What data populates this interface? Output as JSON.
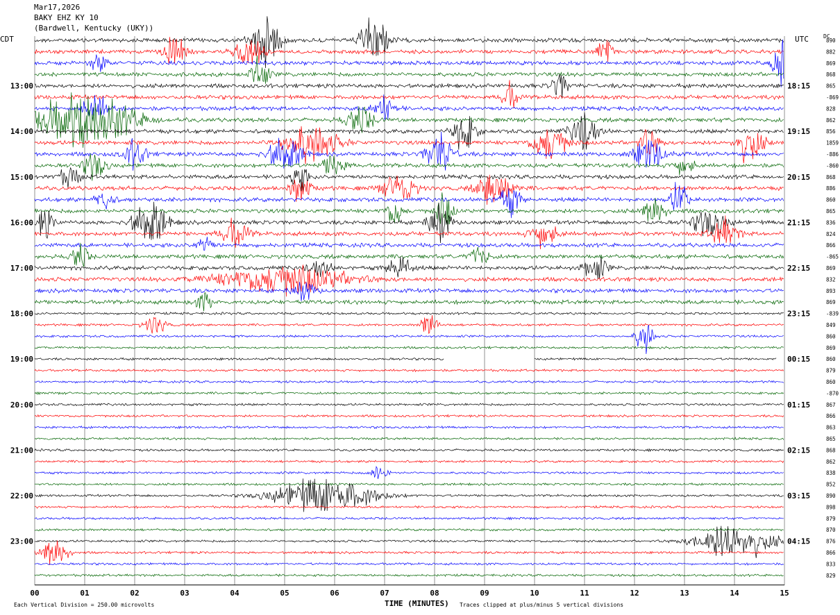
{
  "header": {
    "date": "Mar17,2026",
    "station": "BAKY EHZ KY 10",
    "location": "(Bardwell, Kentucky (UKY))"
  },
  "left_axis_label": "CDT",
  "right_axis_label": "UTC",
  "dc_label": "DC",
  "footer": {
    "scale_note": "Each Vertical Division =  250.00 microvolts",
    "xlabel": "TIME (MINUTES)",
    "clip_note": "Traces clipped at plus/minus 5 vertical divisions"
  },
  "chart_data": {
    "type": "line",
    "xlabel": "TIME (MINUTES)",
    "xlim": [
      0,
      15
    ],
    "x_ticks": [
      "00",
      "01",
      "02",
      "03",
      "04",
      "05",
      "06",
      "07",
      "08",
      "09",
      "10",
      "11",
      "12",
      "13",
      "14",
      "15"
    ],
    "row_minutes": 15,
    "row_count": 48,
    "row_colors": [
      "#000000",
      "#ff0000",
      "#0000ff",
      "#006400"
    ],
    "left_ticks": [
      {
        "row": 4,
        "label": "13:00"
      },
      {
        "row": 8,
        "label": "14:00"
      },
      {
        "row": 12,
        "label": "15:00"
      },
      {
        "row": 16,
        "label": "16:00"
      },
      {
        "row": 20,
        "label": "17:00"
      },
      {
        "row": 24,
        "label": "18:00"
      },
      {
        "row": 28,
        "label": "19:00"
      },
      {
        "row": 32,
        "label": "20:00"
      },
      {
        "row": 36,
        "label": "21:00"
      },
      {
        "row": 40,
        "label": "22:00"
      },
      {
        "row": 44,
        "label": "23:00"
      }
    ],
    "right_ticks": [
      {
        "row": 4,
        "label": "18:15"
      },
      {
        "row": 8,
        "label": "19:15"
      },
      {
        "row": 12,
        "label": "20:15"
      },
      {
        "row": 16,
        "label": "21:15"
      },
      {
        "row": 20,
        "label": "22:15"
      },
      {
        "row": 24,
        "label": "23:15"
      },
      {
        "row": 28,
        "label": "00:15"
      },
      {
        "row": 32,
        "label": "01:15"
      },
      {
        "row": 36,
        "label": "02:15"
      },
      {
        "row": 40,
        "label": "03:15"
      },
      {
        "row": 44,
        "label": "04:15"
      }
    ],
    "dc_values": [
      "890",
      "882",
      "869",
      "868",
      "865",
      "-869",
      "828",
      "862",
      "856",
      "1859",
      "-886",
      "-860",
      "868",
      "886",
      "860",
      "865",
      "836",
      "824",
      "866",
      "-865",
      "869",
      "832",
      "893",
      "869",
      "-839",
      "849",
      "860",
      "869",
      "860",
      "879",
      "860",
      "-870",
      "867",
      "866",
      "863",
      "865",
      "868",
      "862",
      "838",
      "852",
      "890",
      "898",
      "879",
      "870",
      "876",
      "866",
      "833",
      "829"
    ],
    "bursts": [
      {
        "row": 0,
        "x": 4.6,
        "amp": 6,
        "width": 0.5
      },
      {
        "row": 0,
        "x": 6.8,
        "amp": 5,
        "width": 0.5
      },
      {
        "row": 1,
        "x": 2.8,
        "amp": 3,
        "width": 0.4
      },
      {
        "row": 1,
        "x": 4.3,
        "amp": 3,
        "width": 0.5
      },
      {
        "row": 1,
        "x": 11.4,
        "amp": 3,
        "width": 0.3
      },
      {
        "row": 2,
        "x": 1.3,
        "amp": 2,
        "width": 0.3
      },
      {
        "row": 2,
        "x": 14.9,
        "amp": 5,
        "width": 0.3
      },
      {
        "row": 3,
        "x": 4.5,
        "amp": 4,
        "width": 0.3
      },
      {
        "row": 4,
        "x": 10.5,
        "amp": 3,
        "width": 0.3
      },
      {
        "row": 5,
        "x": 9.5,
        "amp": 3,
        "width": 0.3
      },
      {
        "row": 6,
        "x": 1.2,
        "amp": 3,
        "width": 0.5
      },
      {
        "row": 6,
        "x": 7.0,
        "amp": 3,
        "width": 0.4
      },
      {
        "row": 7,
        "x": 1.0,
        "amp": 6,
        "width": 1.8
      },
      {
        "row": 7,
        "x": 6.5,
        "amp": 3,
        "width": 0.5
      },
      {
        "row": 8,
        "x": 8.6,
        "amp": 4,
        "width": 0.4
      },
      {
        "row": 8,
        "x": 11.0,
        "amp": 4,
        "width": 0.5
      },
      {
        "row": 9,
        "x": 5.5,
        "amp": 4,
        "width": 1.0
      },
      {
        "row": 9,
        "x": 10.3,
        "amp": 4,
        "width": 0.6
      },
      {
        "row": 9,
        "x": 14.3,
        "amp": 4,
        "width": 0.5
      },
      {
        "row": 9,
        "x": 12.3,
        "amp": 3,
        "width": 0.4
      },
      {
        "row": 10,
        "x": 5.0,
        "amp": 4,
        "width": 0.6
      },
      {
        "row": 10,
        "x": 8.1,
        "amp": 4,
        "width": 0.5
      },
      {
        "row": 10,
        "x": 2.0,
        "amp": 3,
        "width": 0.4
      },
      {
        "row": 10,
        "x": 12.3,
        "amp": 3,
        "width": 0.6
      },
      {
        "row": 11,
        "x": 1.2,
        "amp": 3,
        "width": 0.4
      },
      {
        "row": 11,
        "x": 6.0,
        "amp": 3,
        "width": 0.4
      },
      {
        "row": 11,
        "x": 13.0,
        "amp": 2,
        "width": 0.4
      },
      {
        "row": 12,
        "x": 5.3,
        "amp": 3,
        "width": 0.3
      },
      {
        "row": 12,
        "x": 0.7,
        "amp": 2,
        "width": 0.4
      },
      {
        "row": 13,
        "x": 5.3,
        "amp": 3,
        "width": 0.4
      },
      {
        "row": 13,
        "x": 7.3,
        "amp": 3,
        "width": 0.6
      },
      {
        "row": 13,
        "x": 9.2,
        "amp": 4,
        "width": 0.6
      },
      {
        "row": 14,
        "x": 1.4,
        "amp": 3,
        "width": 0.3
      },
      {
        "row": 14,
        "x": 9.5,
        "amp": 3,
        "width": 0.4
      },
      {
        "row": 14,
        "x": 12.9,
        "amp": 4,
        "width": 0.3
      },
      {
        "row": 15,
        "x": 7.2,
        "amp": 3,
        "width": 0.3
      },
      {
        "row": 15,
        "x": 8.2,
        "amp": 4,
        "width": 0.3
      },
      {
        "row": 15,
        "x": 12.4,
        "amp": 3,
        "width": 0.4
      },
      {
        "row": 16,
        "x": 2.3,
        "amp": 5,
        "width": 0.6
      },
      {
        "row": 16,
        "x": 8.1,
        "amp": 4,
        "width": 0.4
      },
      {
        "row": 16,
        "x": 13.5,
        "amp": 3,
        "width": 0.6
      },
      {
        "row": 16,
        "x": 0.2,
        "amp": 3,
        "width": 0.3
      },
      {
        "row": 17,
        "x": 4.0,
        "amp": 3,
        "width": 0.5
      },
      {
        "row": 17,
        "x": 10.2,
        "amp": 3,
        "width": 0.5
      },
      {
        "row": 17,
        "x": 13.8,
        "amp": 3,
        "width": 0.5
      },
      {
        "row": 18,
        "x": 3.4,
        "amp": 2,
        "width": 0.3
      },
      {
        "row": 19,
        "x": 0.9,
        "amp": 3,
        "width": 0.3
      },
      {
        "row": 19,
        "x": 8.9,
        "amp": 3,
        "width": 0.3
      },
      {
        "row": 20,
        "x": 7.3,
        "amp": 3,
        "width": 0.4
      },
      {
        "row": 20,
        "x": 11.2,
        "amp": 3,
        "width": 0.4
      },
      {
        "row": 20,
        "x": 5.7,
        "amp": 2,
        "width": 0.4
      },
      {
        "row": 21,
        "x": 5.0,
        "amp": 3,
        "width": 2.4
      },
      {
        "row": 22,
        "x": 5.4,
        "amp": 2,
        "width": 0.4
      },
      {
        "row": 23,
        "x": 3.4,
        "amp": 2,
        "width": 0.3
      },
      {
        "row": 25,
        "x": 2.4,
        "amp": 2,
        "width": 0.4
      },
      {
        "row": 25,
        "x": 7.9,
        "amp": 3,
        "width": 0.3
      },
      {
        "row": 26,
        "x": 12.2,
        "amp": 4,
        "width": 0.3
      },
      {
        "row": 38,
        "x": 6.9,
        "amp": 2,
        "width": 0.3
      },
      {
        "row": 40,
        "x": 5.8,
        "amp": 4,
        "width": 1.8
      },
      {
        "row": 44,
        "x": 14.0,
        "amp": 4,
        "width": 1.4
      },
      {
        "row": 45,
        "x": 0.4,
        "amp": 3,
        "width": 0.5
      }
    ],
    "gaps": [
      {
        "row": 28,
        "x0": 8.2,
        "x1": 10.0
      },
      {
        "row": 28,
        "x0": 14.85,
        "x1": 15.0
      }
    ]
  }
}
